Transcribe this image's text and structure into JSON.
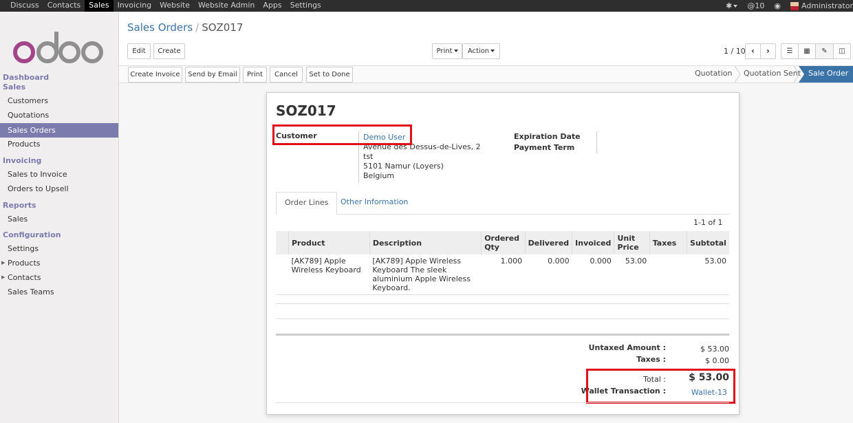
{
  "topmenu": [
    "Discuss",
    "Contacts",
    "Sales",
    "Invoicing",
    "Website",
    "Website Admin",
    "Apps",
    "Settings"
  ],
  "topright": {
    "messages": "@10",
    "user": "Administrator"
  },
  "logo": "odoo",
  "sidebar": {
    "dashboard": "Dashboard",
    "sales_section": "Sales",
    "sales_items": [
      "Customers",
      "Quotations",
      "Sales Orders",
      "Products"
    ],
    "invoicing_section": "Invoicing",
    "invoicing_items": [
      "Sales to Invoice",
      "Orders to Upsell"
    ],
    "reports_section": "Reports",
    "reports_items": [
      "Sales"
    ],
    "config_section": "Configuration",
    "config_items": [
      "Settings",
      "Products",
      "Contacts",
      "Sales Teams"
    ]
  },
  "breadcrumb": {
    "parent": "Sales Orders",
    "current": "SOZ017"
  },
  "buttons": {
    "edit": "Edit",
    "create": "Create",
    "print": "Print",
    "action": "Action"
  },
  "pager": "1 / 10",
  "actions": [
    "Create Invoice",
    "Send by Email",
    "Print",
    "Cancel",
    "Set to Done"
  ],
  "stages": [
    "Quotation",
    "Quotation Sent",
    "Sale Order"
  ],
  "order": {
    "name": "SOZ017",
    "customer_label": "Customer",
    "customer_name": "Demo User",
    "address": [
      "Avenue des Dessus-de-Lives, 2",
      "tst",
      "5101 Namur (Loyers)",
      "Belgium"
    ],
    "expiration_label": "Expiration Date",
    "payment_term_label": "Payment Term"
  },
  "tabs": [
    "Order Lines",
    "Other Information"
  ],
  "table": {
    "counter": "1-1 of 1",
    "headers": [
      "Product",
      "Description",
      "Ordered Qty",
      "Delivered",
      "Invoiced",
      "Unit Price",
      "Taxes",
      "Subtotal"
    ],
    "rows": [
      {
        "product": "[AK789] Apple Wireless Keyboard",
        "description": "[AK789] Apple Wireless Keyboard The sleek aluminium Apple Wireless Keyboard.",
        "ordered": "1.000",
        "delivered": "0.000",
        "invoiced": "0.000",
        "unit_price": "53.00",
        "taxes": "",
        "subtotal": "53.00"
      }
    ]
  },
  "totals": {
    "untaxed_label": "Untaxed Amount :",
    "untaxed_value": "$ 53.00",
    "taxes_label": "Taxes :",
    "taxes_value": "$ 0.00",
    "total_label": "Total :",
    "total_value": "$ 53.00",
    "wallet_label": "Wallet Transaction :",
    "wallet_value": "Wallet-13"
  }
}
